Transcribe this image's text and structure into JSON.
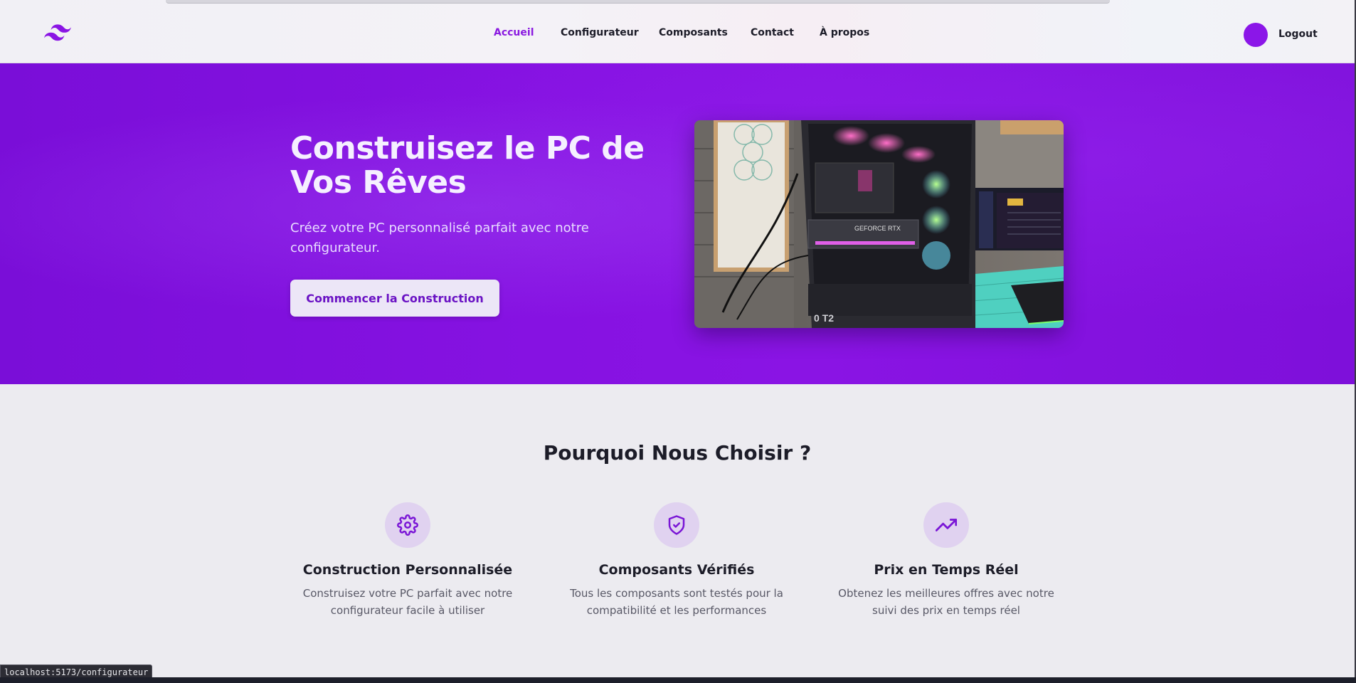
{
  "header": {
    "logo_icon": "tailwind-wave-logo",
    "nav": [
      "Accueil",
      "Configurateur",
      "Composants",
      "Contact",
      "À propos"
    ],
    "active_nav": "Accueil",
    "logout_label": "Logout"
  },
  "hero": {
    "title": "Construisez le PC de Vos Rêves",
    "subtitle": "Créez votre PC personnalisé parfait avec notre configurateur.",
    "cta_label": "Commencer la Construction",
    "image_alt": "pc-build-rgb-photo",
    "accent": "#8a14e4"
  },
  "features": {
    "title": "Pourquoi Nous Choisir ?",
    "items": [
      {
        "icon": "gear-icon",
        "title": "Construction Personnalisée",
        "text": "Construisez votre PC parfait avec notre configurateur facile à utiliser"
      },
      {
        "icon": "shield-check-icon",
        "title": "Composants Vérifiés",
        "text": "Tous les composants sont testés pour la compatibilité et les performances"
      },
      {
        "icon": "trending-up-icon",
        "title": "Prix en Temps Réel",
        "text": "Obtenez les meilleures offres avec notre suivi des prix en temps réel"
      }
    ]
  },
  "status_bar": {
    "url": "localhost:5173/configurateur"
  }
}
